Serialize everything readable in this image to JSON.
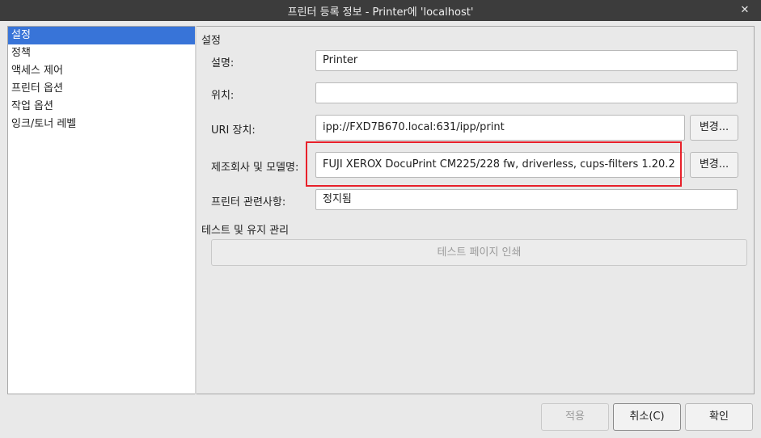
{
  "window": {
    "title": "프린터 등록 정보 - Printer에 'localhost'",
    "close_glyph": "✕"
  },
  "sidebar": {
    "items": [
      {
        "label": "설정",
        "selected": true
      },
      {
        "label": "정책"
      },
      {
        "label": "액세스 제어"
      },
      {
        "label": "프린터 옵션"
      },
      {
        "label": "작업 옵션"
      },
      {
        "label": "잉크/토너 레벨"
      }
    ]
  },
  "settings": {
    "section_title": "설정",
    "description_label": "설명:",
    "description_value": "Printer",
    "location_label": "위치:",
    "location_value": "",
    "uri_label": "URI 장치:",
    "uri_value": "ipp://FXD7B670.local:631/ipp/print",
    "uri_change_button": "변경...",
    "model_label": "제조회사 및 모델명:",
    "model_value": "FUJI XEROX DocuPrint CM225/228 fw, driverless, cups-filters 1.20.2",
    "model_change_button": "변경...",
    "state_label": "프린터 관련사항:",
    "state_value": "정지됨"
  },
  "maintenance": {
    "section_title": "테스트 및 유지 관리",
    "test_page_button": "테스트 페이지 인쇄"
  },
  "footer": {
    "apply_button": "적용",
    "cancel_button": "취소(C)",
    "ok_button": "확인"
  },
  "colors": {
    "selection": "#3874d8",
    "highlight_box": "#e8202a",
    "titlebar": "#3c3c3c"
  }
}
